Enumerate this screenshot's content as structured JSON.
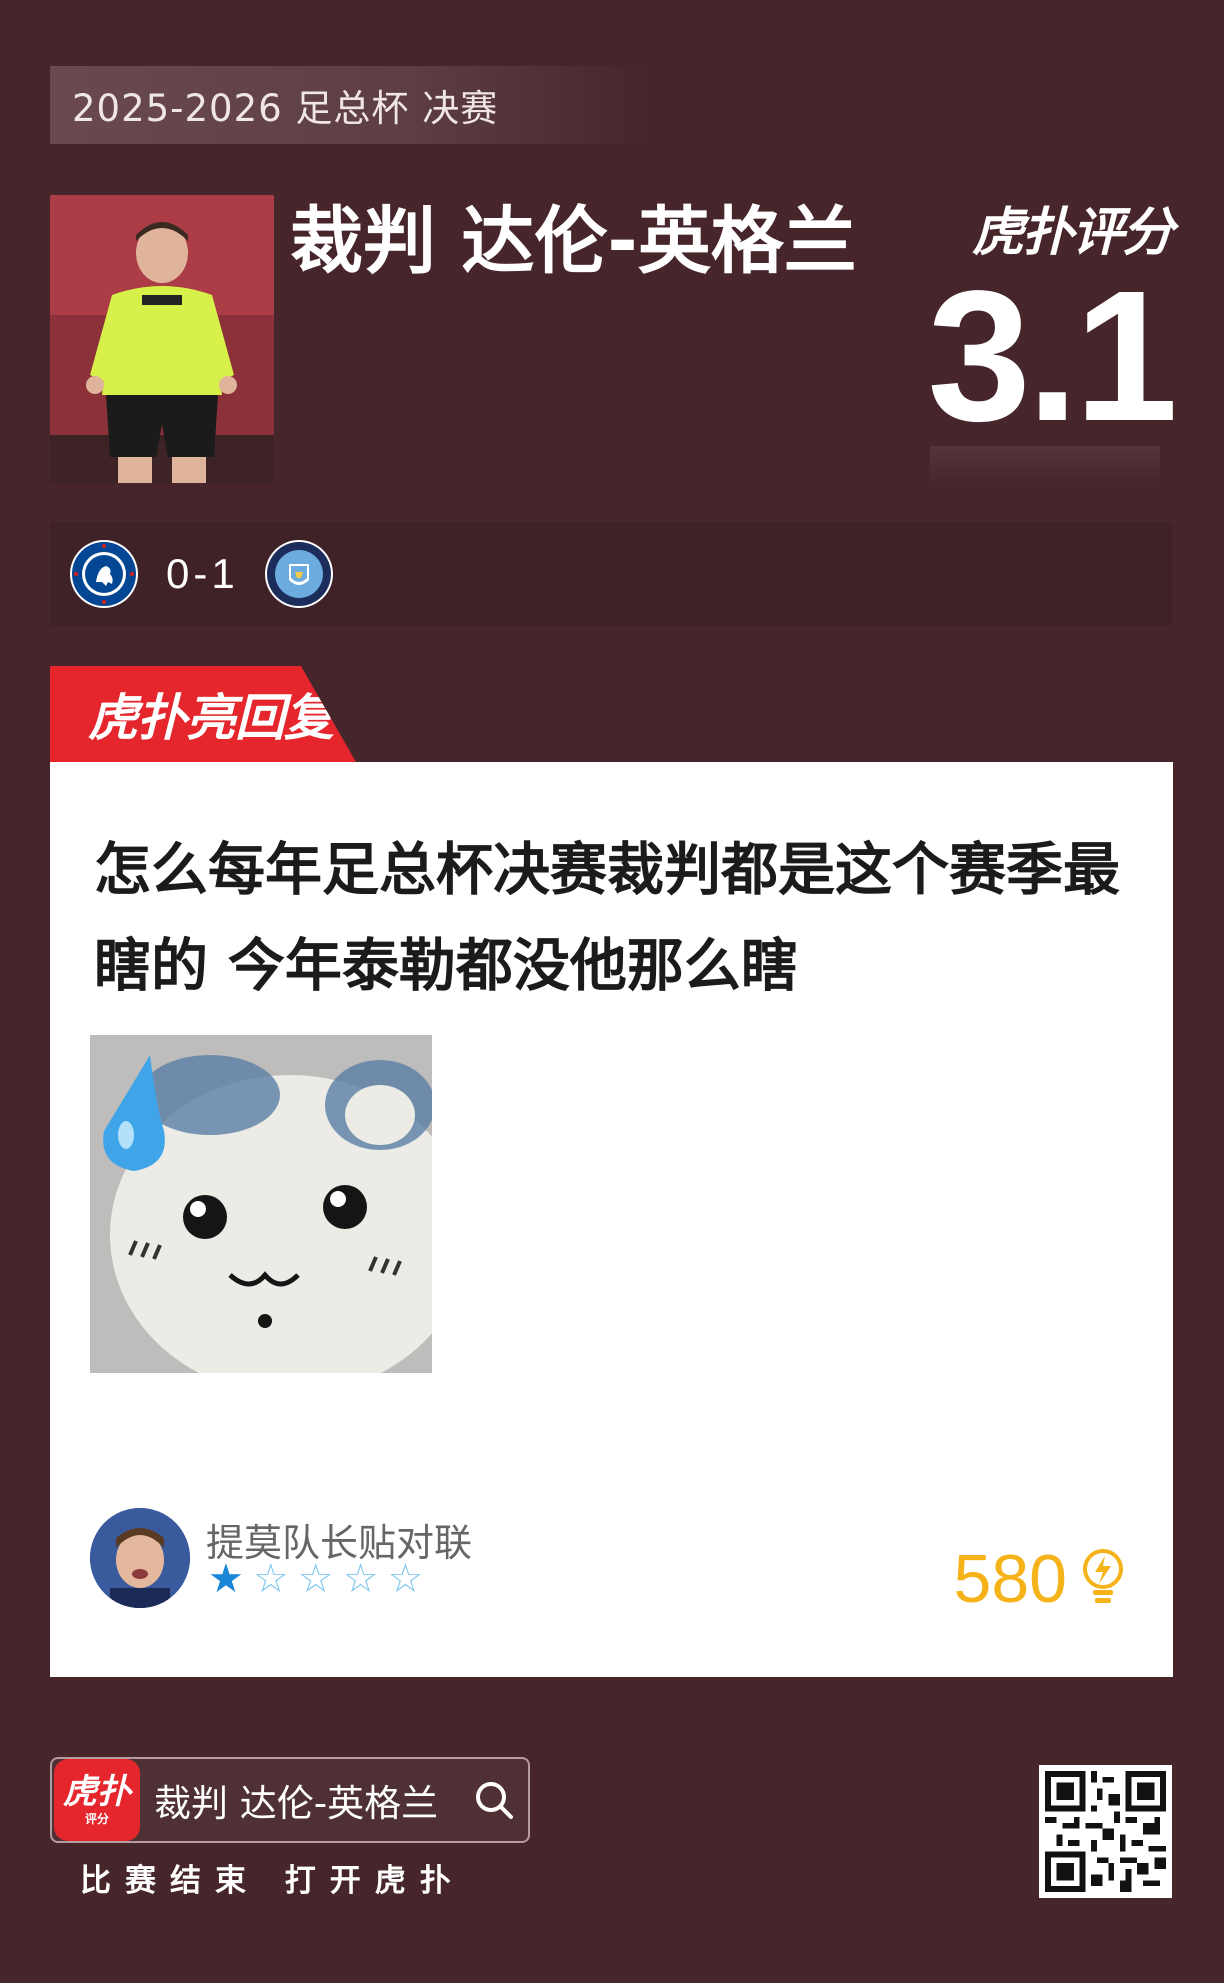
{
  "event": {
    "label": "2025-2026 足总杯 决赛"
  },
  "header": {
    "title": "裁判 达伦-英格兰",
    "brand": "虎扑评分",
    "score": "3.1"
  },
  "match": {
    "home_team": "Chelsea",
    "away_team": "Manchester City",
    "score": "0-1"
  },
  "highlight": {
    "label": "虎扑亮回复"
  },
  "reply": {
    "text": "怎么每年足总杯决赛裁判都是这个赛季最瞎的 今年泰勒都没他那么瞎",
    "username": "提莫队长贴对联",
    "rating_stars": 1,
    "rating_max": 5,
    "likes": "580"
  },
  "footer": {
    "app_icon_big": "虎扑",
    "app_icon_small": "评分",
    "search_text": "裁判 达伦-英格兰",
    "caption": "比赛结束 打开虎扑"
  },
  "colors": {
    "background": "#46262b",
    "accent_red": "#e5262c",
    "likes_yellow": "#f5b319",
    "star_blue": "#1a86d6"
  }
}
